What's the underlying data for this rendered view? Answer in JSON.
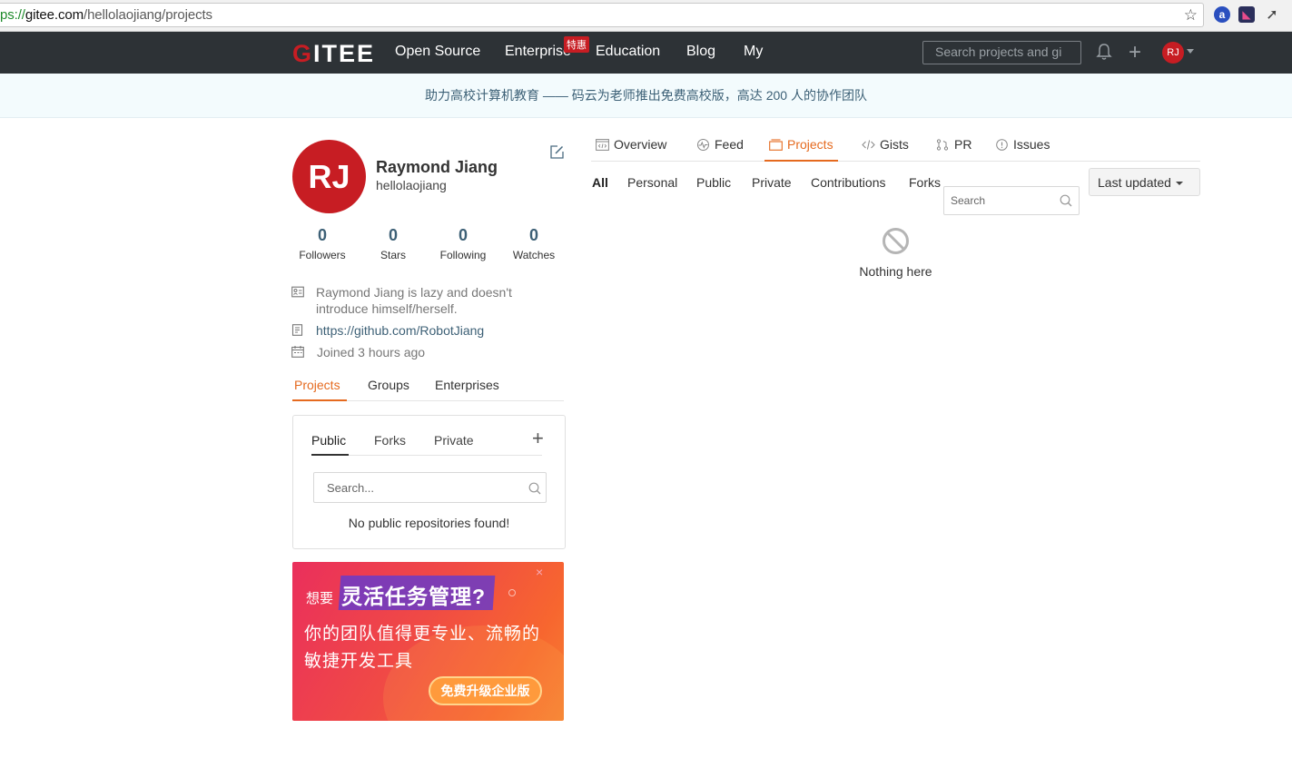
{
  "browser": {
    "url_scheme": "ps://",
    "url_host": "gitee.com",
    "url_path": "/hellolaojiang/projects"
  },
  "nav": {
    "logo": "GITEE",
    "items": [
      "Open Source",
      "Enterprise",
      "Education",
      "Blog",
      "My"
    ],
    "enterprise_badge": "特惠",
    "search_placeholder": "Search projects and gi",
    "avatar_initials": "RJ"
  },
  "banner": {
    "text": "助力高校计算机教育 —— 码云为老师推出免费高校版，高达 200 人的协作团队"
  },
  "profile": {
    "avatar_initials": "RJ",
    "name": "Raymond Jiang",
    "login": "hellolaojiang",
    "stats": [
      {
        "value": "0",
        "label": "Followers"
      },
      {
        "value": "0",
        "label": "Stars"
      },
      {
        "value": "0",
        "label": "Following"
      },
      {
        "value": "0",
        "label": "Watches"
      }
    ],
    "bio": "Raymond Jiang is lazy and doesn't introduce himself/herself.",
    "website": "https://github.com/RobotJiang",
    "joined": "Joined 3 hours ago"
  },
  "left_tabs": [
    "Projects",
    "Groups",
    "Enterprises"
  ],
  "repo_box": {
    "tabs": [
      "Public",
      "Forks",
      "Private"
    ],
    "search_placeholder": "Search...",
    "empty": "No public repositories found!"
  },
  "promo": {
    "line1": "想要",
    "line2": "灵活任务管理?",
    "line3": "你的团队值得更专业、流畅的",
    "line4": "敏捷开发工具",
    "cta": "免费升级企业版",
    "close": "×"
  },
  "main_tabs": [
    "Overview",
    "Feed",
    "Projects",
    "Gists",
    "PR",
    "Issues"
  ],
  "filter_tabs": [
    "All",
    "Personal",
    "Public",
    "Private",
    "Contributions",
    "Forks"
  ],
  "main_search_placeholder": "Search",
  "sort_label": "Last updated",
  "empty_message": "Nothing here",
  "colors": {
    "accent": "#e56a1f",
    "brand_red": "#c71d23",
    "nav_bg": "#2d3236",
    "link": "#3d6076"
  }
}
